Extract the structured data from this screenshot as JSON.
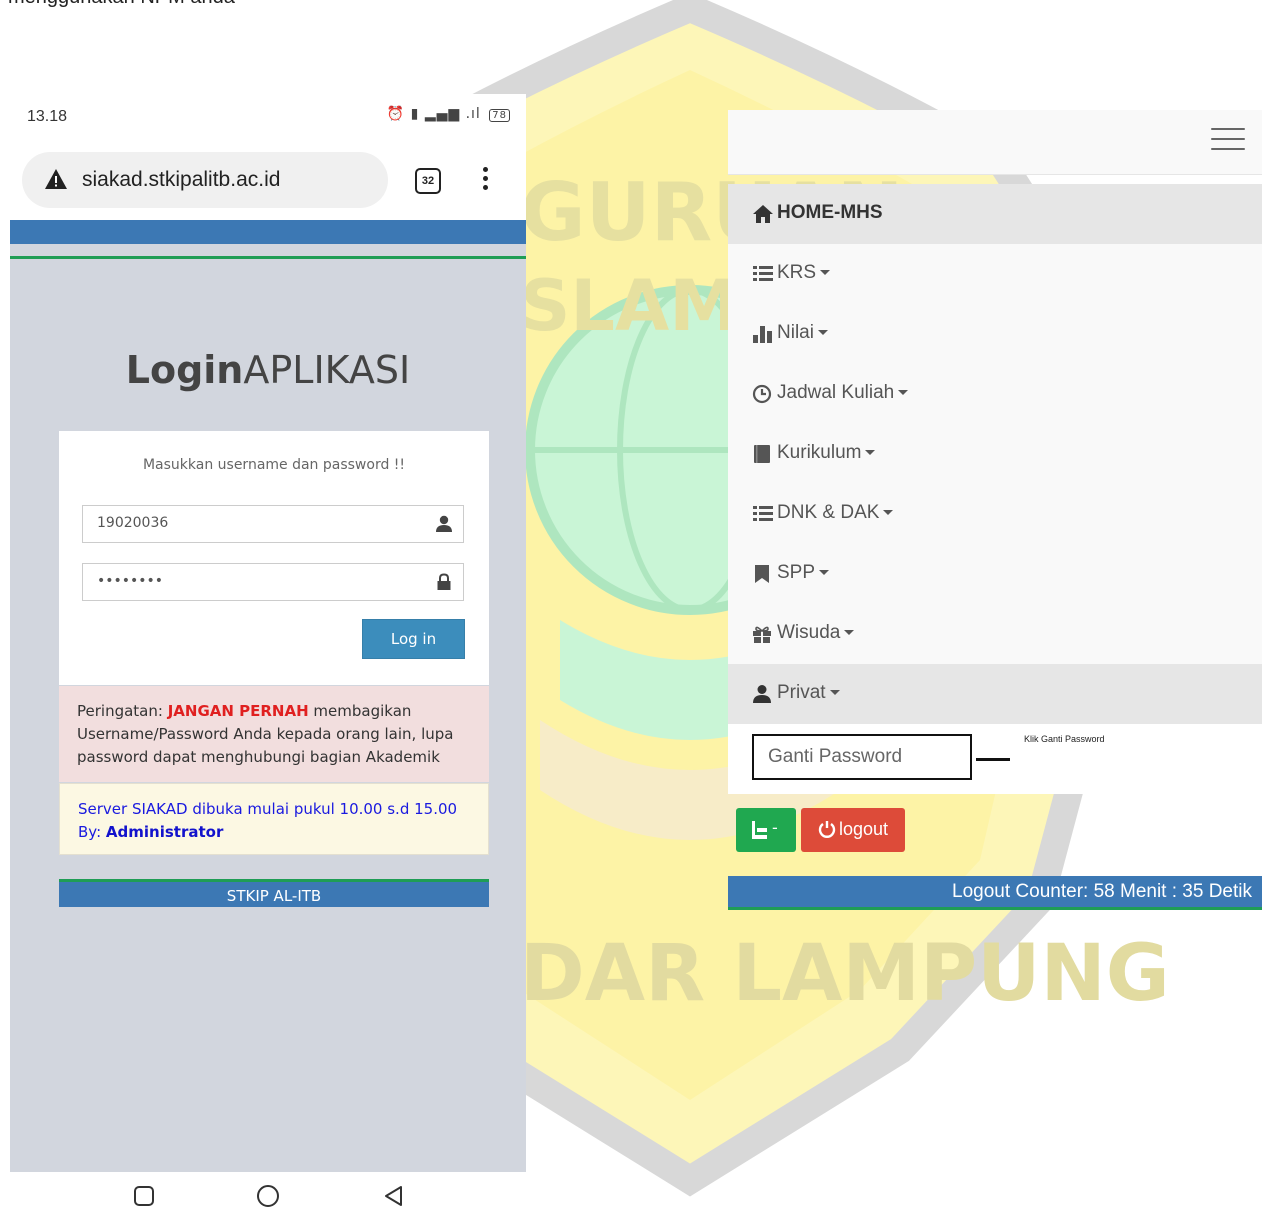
{
  "document": {
    "caption": "menggunakan NPM anda",
    "watermark": {
      "text_top": "GURUAN",
      "text_mid": "SLAM",
      "text_bottom": "DAR LAMPUNG"
    }
  },
  "phone": {
    "status_bar": {
      "time": "13.18",
      "battery": "78"
    },
    "browser": {
      "url": "siakad.stkipalitb.ac.id",
      "tab_count": "32"
    },
    "login": {
      "title_bold": "Login",
      "title_light": "APLIKASI",
      "message": "Masukkan username dan password !!",
      "username_value": "19020036",
      "password_value": "••••••••",
      "button_label": "Log in"
    },
    "warning": {
      "prefix": "Peringatan: ",
      "emphasis": "JANGAN PERNAH",
      "suffix": " membagikan Username/Password Anda kepada orang lain, lupa password dapat menghubungi bagian Akademik"
    },
    "info": {
      "line1": "Server SIAKAD dibuka mulai pukul 10.00 s.d 15.00",
      "by_label": "By: ",
      "by_name": "Administrator"
    },
    "footer": "STKIP AL-ITB"
  },
  "panel": {
    "menu": [
      {
        "label": "HOME-MHS",
        "icon": "home-icon"
      },
      {
        "label": "KRS",
        "icon": "list-icon"
      },
      {
        "label": "Nilai",
        "icon": "bar-chart-icon"
      },
      {
        "label": "Jadwal Kuliah",
        "icon": "clock-icon"
      },
      {
        "label": "Kurikulum",
        "icon": "book-icon"
      },
      {
        "label": "DNK & DAK",
        "icon": "list-icon"
      },
      {
        "label": "SPP",
        "icon": "bookmark-icon"
      },
      {
        "label": "Wisuda",
        "icon": "gift-icon"
      },
      {
        "label": "Privat",
        "icon": "user-icon"
      }
    ],
    "submenu_item": "Ganti Password",
    "callout": "Klik Ganti Password",
    "green_button": "-",
    "logout_label": "logout",
    "counter": "Logout Counter: 58 Menit : 35 Detik"
  },
  "colors": {
    "primary_blue": "#3c78b4",
    "accent_green": "#1f9d55",
    "danger_red": "#dd4b39",
    "login_btn": "#3c8dbc"
  }
}
